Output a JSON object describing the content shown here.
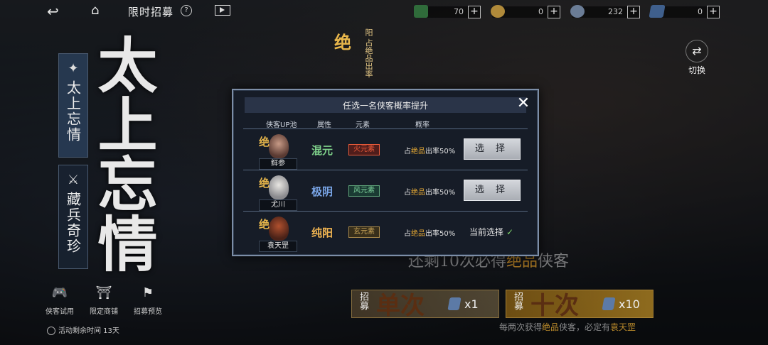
{
  "topbar": {
    "title": "限时招募",
    "help_icon": "?",
    "resources": [
      {
        "name": "jade",
        "value": "70"
      },
      {
        "name": "gold",
        "value": "0"
      },
      {
        "name": "silver",
        "value": "232"
      },
      {
        "name": "ticket",
        "value": "0"
      }
    ],
    "plus": "+"
  },
  "left_tabs": [
    {
      "label": "太上忘情"
    },
    {
      "label": "藏兵奇珍"
    }
  ],
  "banner_calligraphy": "太上忘情",
  "side_badge": {
    "jue": "绝",
    "text": "阳 占绝品出率"
  },
  "switch_label": "切换",
  "tools": [
    {
      "label": "侠客试用"
    },
    {
      "label": "限定商铺"
    },
    {
      "label": "招募预览"
    }
  ],
  "timer": "活动剩余时间 13天",
  "remaining": {
    "pre": "还剩10次必得",
    "hl": "绝品",
    "post": "侠客"
  },
  "pulls": [
    {
      "small": "招募",
      "big": "单次",
      "count": "x1"
    },
    {
      "small": "招募",
      "big": "十次",
      "count": "x10"
    }
  ],
  "bottom_note": {
    "pre": "每两次获得",
    "hl": "绝品",
    "mid": "侠客，必定有",
    "hl2": "袁天罡"
  },
  "modal": {
    "title": "任选一名侠客概率提升",
    "columns": [
      "侠客UP池",
      "属性",
      "元素",
      "概率"
    ],
    "rows": [
      {
        "name": "鲜参",
        "jue": "绝",
        "attr": "混元",
        "attr_color": "#7ed08a",
        "element": "火元素",
        "elem_color": "#e85a3a",
        "rate_pre": "占",
        "rate_hl": "绝品",
        "rate_post": "出率50%",
        "action": "选 择"
      },
      {
        "name": "尤川",
        "jue": "绝",
        "attr": "极阴",
        "attr_color": "#7aa6e8",
        "element": "风元素",
        "elem_color": "#7ccf9a",
        "rate_pre": "占",
        "rate_hl": "绝品",
        "rate_post": "出率50%",
        "action": "选 择"
      },
      {
        "name": "袁天罡",
        "jue": "绝",
        "attr": "纯阳",
        "attr_color": "#f0b451",
        "element": "玄元素",
        "elem_color": "#c9a458",
        "rate_pre": "占",
        "rate_hl": "绝品",
        "rate_post": "出率50%",
        "action": "当前选择"
      }
    ]
  }
}
